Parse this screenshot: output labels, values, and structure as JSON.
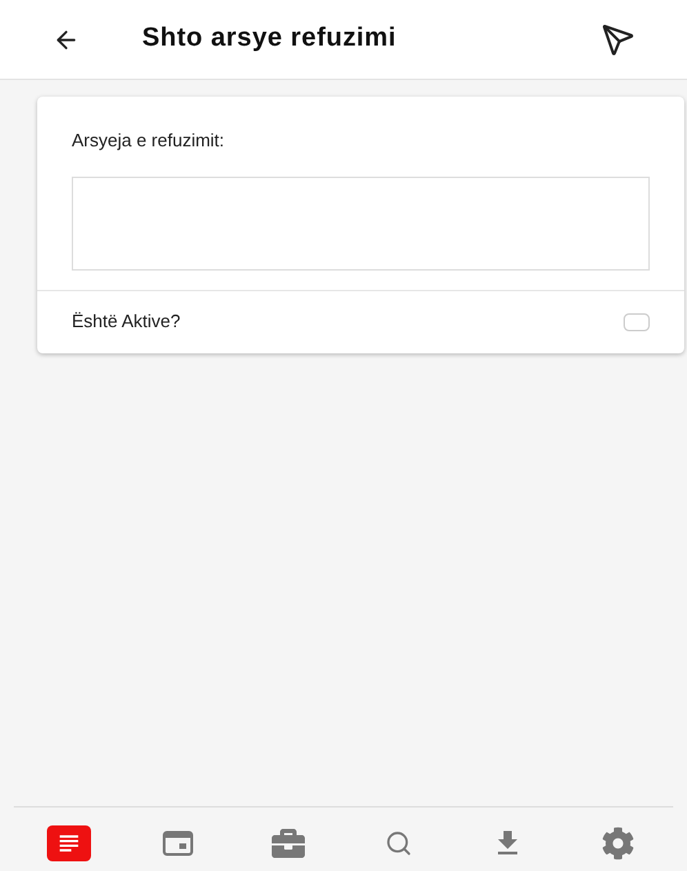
{
  "header": {
    "title": "Shto arsye refuzimi"
  },
  "form": {
    "reason_label": "Arsyeja e refuzimit:",
    "active_label": "Është Aktive?",
    "active_checked": false
  },
  "nav": [
    {
      "kind": "list",
      "selected": true
    },
    {
      "kind": "calendar",
      "selected": false
    },
    {
      "kind": "briefcase",
      "selected": false
    },
    {
      "kind": "search",
      "selected": false
    },
    {
      "kind": "download",
      "selected": false
    },
    {
      "kind": "settings",
      "selected": false
    }
  ]
}
